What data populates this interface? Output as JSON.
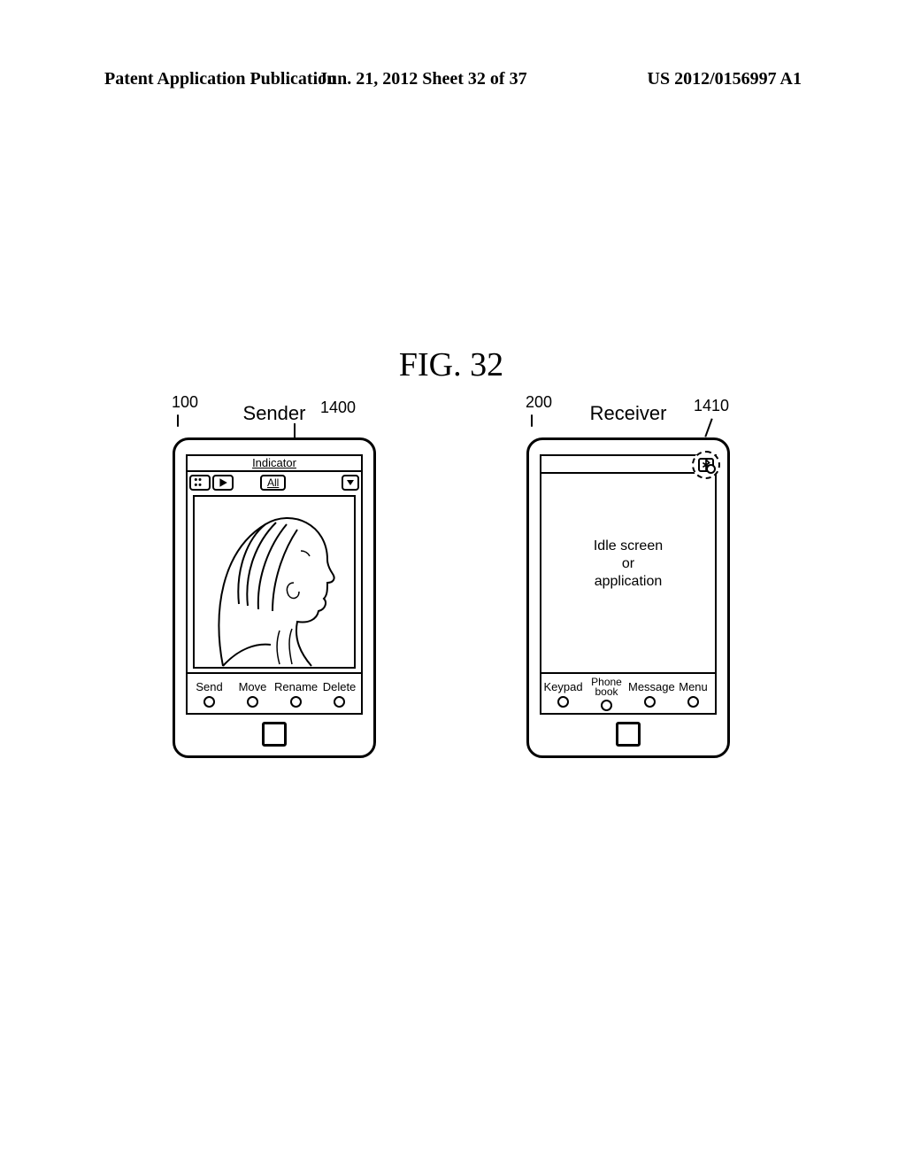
{
  "header": {
    "left": "Patent Application Publication",
    "center": "Jun. 21, 2012  Sheet 32 of 37",
    "right": "US 2012/0156997 A1"
  },
  "figure": {
    "title": "FIG. 32"
  },
  "sender": {
    "ref_body": "100",
    "title": "Sender",
    "ref_indicator": "1400",
    "indicator_label": "Indicator",
    "all_label": "All",
    "actions": [
      "Send",
      "Move",
      "Rename",
      "Delete"
    ]
  },
  "receiver": {
    "ref_body": "200",
    "title": "Receiver",
    "ref_icon": "1410",
    "center_lines": [
      "Idle screen",
      "or",
      "application"
    ],
    "actions": [
      {
        "label": "Keypad",
        "twoline": false
      },
      {
        "label": "Phone\nbook",
        "twoline": true
      },
      {
        "label": "Message",
        "twoline": false
      },
      {
        "label": "Menu",
        "twoline": false
      }
    ]
  }
}
